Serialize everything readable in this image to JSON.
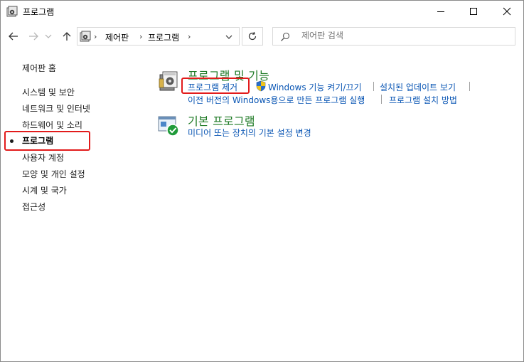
{
  "window": {
    "title": "프로그램"
  },
  "address": {
    "crumbs": [
      "제어판",
      "프로그램"
    ]
  },
  "search": {
    "placeholder": "제어판 검색"
  },
  "sidebar": {
    "home": "제어판 홈",
    "items": [
      {
        "label": "시스템 및 보안"
      },
      {
        "label": "네트워크 및 인터넷"
      },
      {
        "label": "하드웨어 및 소리"
      },
      {
        "label": "프로그램",
        "active": true
      },
      {
        "label": "사용자 계정"
      },
      {
        "label": "모양 및 개인 설정"
      },
      {
        "label": "시계 및 국가"
      },
      {
        "label": "접근성"
      }
    ]
  },
  "main": {
    "sections": [
      {
        "title": "프로그램 및 기능",
        "icon": "programs-features-icon",
        "links": [
          "프로그램 제거",
          "Windows 기능 켜기/끄기",
          "설치된 업데이트 보기",
          "이전 버전의 Windows용으로 만든 프로그램 실행",
          "프로그램 설치 방법"
        ]
      },
      {
        "title": "기본 프로그램",
        "icon": "default-programs-icon",
        "links": [
          "미디어 또는 장치의 기본 설정 변경"
        ]
      }
    ]
  },
  "colors": {
    "category_title": "#1e7a25",
    "link": "#0a56b4",
    "highlight": "#e21b1b"
  }
}
